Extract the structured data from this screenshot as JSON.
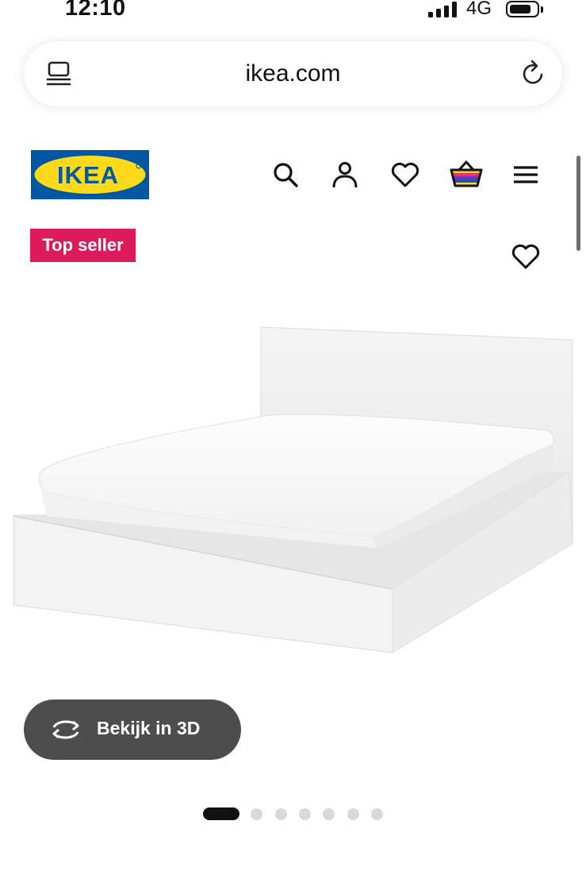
{
  "status_bar": {
    "time": "12:10",
    "network": "4G",
    "signal_bars": 4,
    "battery_level": 0.7
  },
  "browser": {
    "url": "ikea.com",
    "tabs_icon": "tabs-icon",
    "reload_icon": "reload-icon"
  },
  "header": {
    "logo_text": "IKEA",
    "icons": [
      "search-icon",
      "account-icon",
      "favourites-icon",
      "basket-icon",
      "menu-icon"
    ]
  },
  "product": {
    "badge": "Top seller",
    "favourite_icon": "heart-icon",
    "view_3d_label": "Bekijk in 3D"
  },
  "carousel": {
    "total": 7,
    "active_index": 0
  },
  "colors": {
    "ikea_blue": "#0058a3",
    "ikea_yellow": "#ffda1a",
    "badge_red": "#dd1a5a",
    "button_gray": "#4d4d4d"
  }
}
